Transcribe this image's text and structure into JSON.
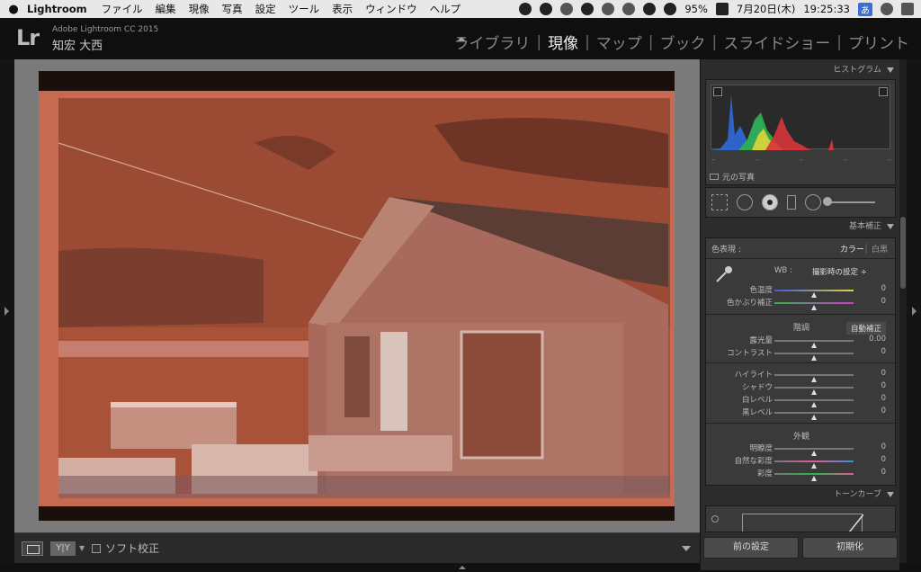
{
  "menubar": {
    "app_name": "Lightroom",
    "items": [
      "ファイル",
      "編集",
      "現像",
      "写真",
      "設定",
      "ツール",
      "表示",
      "ウィンドウ",
      "ヘルプ"
    ],
    "battery": "95%",
    "date": "7月20日(木)",
    "time": "19:25:33",
    "input_badge": "あ"
  },
  "identity": {
    "logo": "Lr",
    "version": "Adobe Lightroom CC 2015",
    "user": "知宏 大西"
  },
  "modules": [
    "ライブラリ",
    "現像",
    "マップ",
    "ブック",
    "スライドショー",
    "プリント"
  ],
  "active_module": "現像",
  "toolbar": {
    "yy": "Y|Y",
    "soft_proof": "ソフト校正"
  },
  "histogram": {
    "title": "ヒストグラム",
    "ticks": [
      "–",
      "–",
      "–",
      "–",
      "–"
    ],
    "original_photo": "元の写真"
  },
  "basic": {
    "title": "基本補正",
    "treatment_label": "色表現 :",
    "treatment_color": "カラー",
    "treatment_bw": "白黒",
    "wb_label": "WB :",
    "wb_value": "撮影時の設定 ÷",
    "tone_title": "階調",
    "auto_label": "自動補正",
    "presence_title": "外観",
    "sliders": [
      {
        "label": "色温度",
        "value": "0",
        "pos": 0.5
      },
      {
        "label": "色かぶり補正",
        "value": "0",
        "pos": 0.5
      },
      {
        "label": "露光量",
        "value": "0.00",
        "pos": 0.5
      },
      {
        "label": "コントラスト",
        "value": "0",
        "pos": 0.5
      },
      {
        "label": "ハイライト",
        "value": "0",
        "pos": 0.5
      },
      {
        "label": "シャドウ",
        "value": "0",
        "pos": 0.5
      },
      {
        "label": "白レベル",
        "value": "0",
        "pos": 0.5
      },
      {
        "label": "黒レベル",
        "value": "0",
        "pos": 0.5
      },
      {
        "label": "明瞭度",
        "value": "0",
        "pos": 0.5
      },
      {
        "label": "自然な彩度",
        "value": "0",
        "pos": 0.5
      },
      {
        "label": "彩度",
        "value": "0",
        "pos": 0.5
      }
    ]
  },
  "tone_curve": {
    "title": "トーンカーブ"
  },
  "footer": {
    "previous": "前の設定",
    "reset": "初期化"
  }
}
